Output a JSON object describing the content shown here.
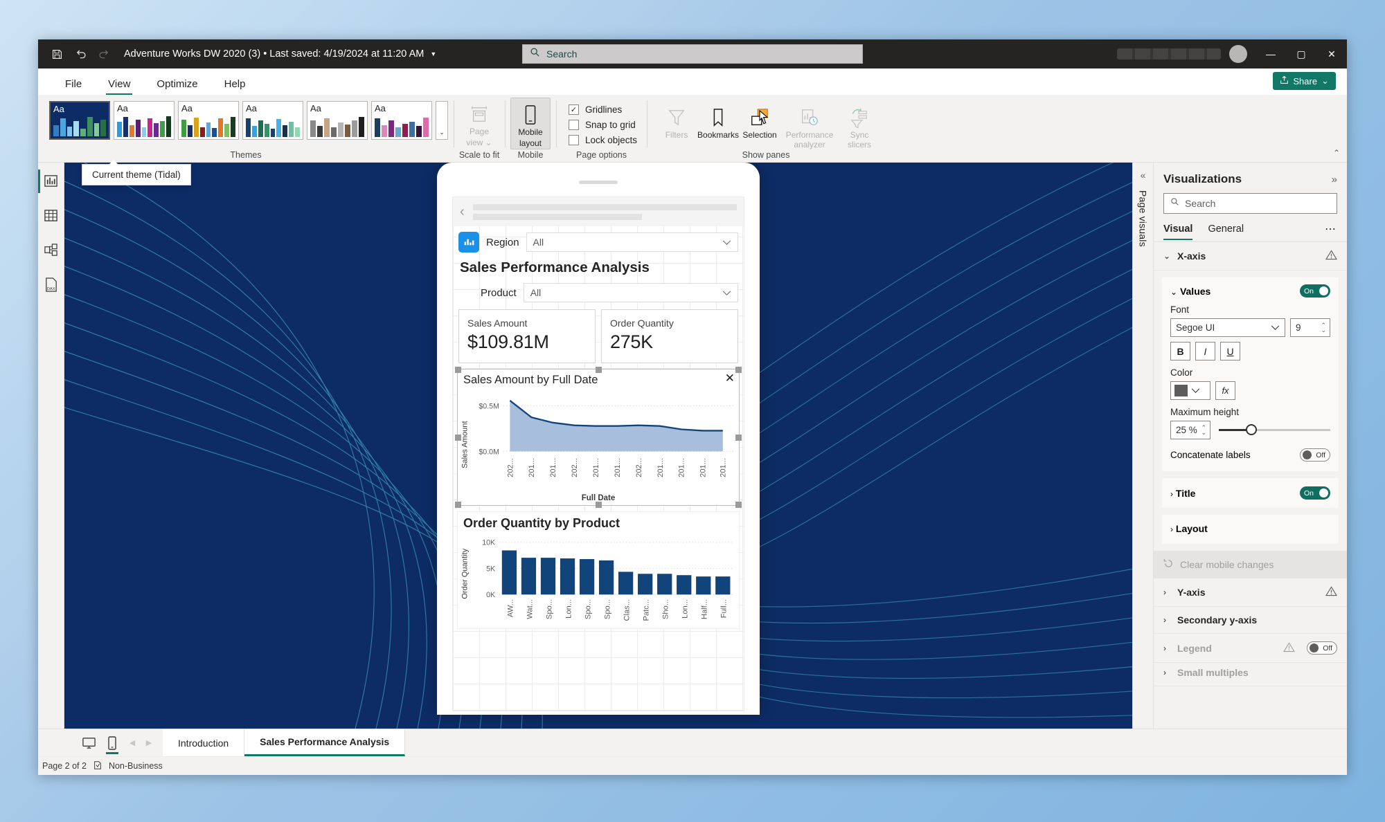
{
  "titlebar": {
    "save_icon": "save-icon",
    "undo_icon": "undo-icon",
    "redo_icon": "redo-icon",
    "document_title": "Adventure Works DW 2020 (3) • Last saved: 4/19/2024 at 11:20 AM",
    "caret": "▼",
    "search_placeholder": "Search",
    "minimize": "—",
    "maximize": "▢",
    "close": "✕"
  },
  "menu": {
    "items": [
      "File",
      "View",
      "Optimize",
      "Help"
    ],
    "active": "View",
    "share_label": "Share",
    "share_caret": "⌄"
  },
  "ribbon": {
    "groups": [
      {
        "label": "Themes"
      },
      {
        "label": "Scale to fit"
      },
      {
        "label": "Mobile"
      },
      {
        "label": "Page options"
      },
      {
        "label": "Show panes"
      }
    ],
    "theme_thumb_text": "Aa",
    "gallery_more": "⌄",
    "scale_to_fit": {
      "line1": "Page",
      "line2": "view ⌄",
      "disabled": true
    },
    "mobile": {
      "line1": "Mobile",
      "line2": "layout",
      "active": true
    },
    "page_options": [
      {
        "label": "Gridlines",
        "checked": true
      },
      {
        "label": "Snap to grid",
        "checked": false
      },
      {
        "label": "Lock objects",
        "checked": false
      }
    ],
    "show_panes": [
      {
        "label": "Filters",
        "disabled": true
      },
      {
        "label": "Bookmarks",
        "disabled": false
      },
      {
        "label": "Selection",
        "disabled": false
      },
      {
        "label": "Performance analyzer",
        "disabled": true
      },
      {
        "label": "Sync slicers",
        "disabled": true
      }
    ],
    "collapse": "⌃",
    "tooltip": "Current theme (Tidal)"
  },
  "left_rail": [
    {
      "name": "report-view-icon"
    },
    {
      "name": "table-view-icon"
    },
    {
      "name": "model-view-icon"
    },
    {
      "name": "dax-query-view-icon"
    }
  ],
  "phone": {
    "back_icon": "‹",
    "slicers": [
      {
        "label": "Region",
        "value": "All"
      },
      {
        "label": "Product",
        "value": "All"
      }
    ],
    "page_title": "Sales Performance Analysis",
    "cards": [
      {
        "label": "Sales Amount",
        "value": "$109.81M"
      },
      {
        "label": "Order Quantity",
        "value": "275K"
      }
    ],
    "close_icon": "✕"
  },
  "page_visuals_tab": {
    "collapse_icon": "«",
    "label": "Page visuals"
  },
  "format_pane": {
    "title": "Visualizations",
    "expand_icon": "»",
    "search_placeholder": "Search",
    "tabs": [
      "Visual",
      "General"
    ],
    "active_tab": "Visual",
    "more_icon": "⋯",
    "sections": [
      {
        "label": "X-axis",
        "expanded": true,
        "warning": true
      },
      {
        "label": "Title",
        "expanded": false,
        "toggle": "On"
      },
      {
        "label": "Layout",
        "expanded": false
      },
      {
        "label": "Y-axis",
        "expanded": false,
        "warning": true
      },
      {
        "label": "Secondary y-axis",
        "expanded": false
      },
      {
        "label": "Legend",
        "expanded": false,
        "warning": true,
        "toggle": "Off",
        "disabled": true
      },
      {
        "label": "Small multiples",
        "expanded": false,
        "disabled": true
      }
    ],
    "values_card": {
      "header": "Values",
      "toggle": "On",
      "font_label": "Font",
      "font_family": "Segoe UI",
      "font_size": "9",
      "bold": "B",
      "italic": "I",
      "underline": "U",
      "color_label": "Color",
      "color_value": "#5c5c5c",
      "fx_label": "fx",
      "max_height_label": "Maximum height",
      "max_height_value": "25 %",
      "concatenate_label": "Concatenate labels",
      "concatenate_toggle": "Off"
    },
    "clear_mobile_changes": "Clear mobile changes"
  },
  "bottom": {
    "desktop_view_icon": "desktop-view-icon",
    "mobile_view_icon": "mobile-view-icon",
    "prev_icon": "◀",
    "next_icon": "▶",
    "tabs": [
      {
        "label": "Introduction",
        "active": false
      },
      {
        "label": "Sales Performance Analysis",
        "active": true
      }
    ],
    "status_page": "Page 2 of 2",
    "status_sensitivity": "Non-Business"
  },
  "chart_data": [
    {
      "type": "area",
      "title": "Sales Amount by Full Date",
      "xlabel": "Full Date",
      "ylabel": "Sales Amount",
      "ytick_labels": [
        "$0.0M",
        "$0.5M"
      ],
      "ylim": [
        0,
        0.6
      ],
      "xtick_labels": [
        "202...",
        "201...",
        "201...",
        "202...",
        "201...",
        "201...",
        "202...",
        "201...",
        "201...",
        "201...",
        "201..."
      ],
      "values": [
        0.545,
        0.455,
        0.415,
        0.392,
        0.388,
        0.388,
        0.39,
        0.387,
        0.365,
        0.358,
        0.357
      ],
      "line_color": "#12447c",
      "fill_color": "#a7bedd",
      "grid": true
    },
    {
      "type": "bar",
      "title": "Order Quantity by Product",
      "xlabel": "",
      "ylabel": "Order Quantity",
      "ytick_labels": [
        "0K",
        "5K",
        "10K"
      ],
      "ylim": [
        0,
        10000
      ],
      "categories": [
        "AW...",
        "Wat...",
        "Spo...",
        "Lon...",
        "Spo...",
        "Spo...",
        "Clas...",
        "Patc...",
        "Sho...",
        "Lon...",
        "Half...",
        "Full..."
      ],
      "values": [
        8500,
        7000,
        7000,
        6850,
        6750,
        6550,
        4350,
        3950,
        3950,
        3750,
        3500,
        3450
      ],
      "bar_color": "#12447c",
      "grid": true
    }
  ]
}
